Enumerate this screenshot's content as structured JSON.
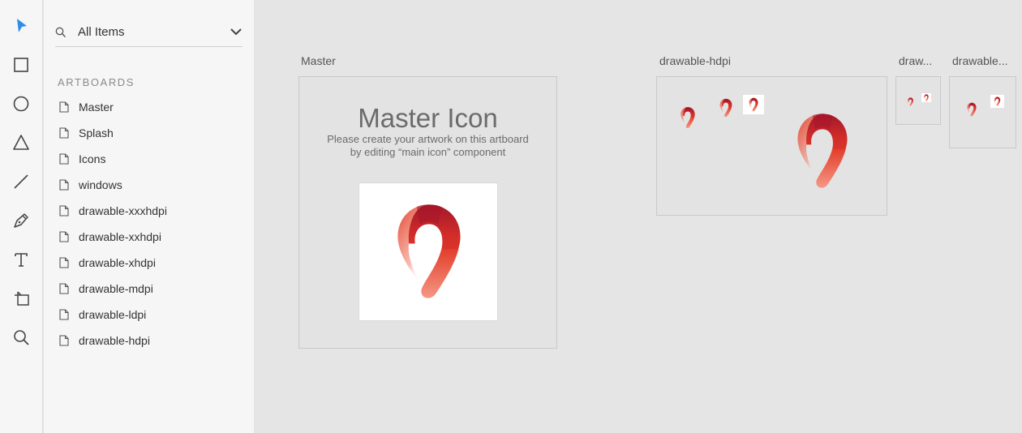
{
  "toolbar": {
    "tools": [
      {
        "name": "select-tool",
        "icon": "arrow-pointer-icon"
      },
      {
        "name": "rectangle-tool",
        "icon": "rectangle-icon"
      },
      {
        "name": "ellipse-tool",
        "icon": "ellipse-icon"
      },
      {
        "name": "polygon-tool",
        "icon": "triangle-icon"
      },
      {
        "name": "line-tool",
        "icon": "line-icon"
      },
      {
        "name": "pen-tool",
        "icon": "pen-icon"
      },
      {
        "name": "text-tool",
        "icon": "text-icon"
      },
      {
        "name": "artboard-tool",
        "icon": "artboard-icon"
      },
      {
        "name": "zoom-tool",
        "icon": "magnifier-icon"
      }
    ],
    "active_color": "#2c8ee8"
  },
  "sidebar": {
    "filter": {
      "value": "All Items"
    },
    "section_title": "ARTBOARDS",
    "items": [
      {
        "label": "Master"
      },
      {
        "label": "Splash"
      },
      {
        "label": "Icons"
      },
      {
        "label": "windows"
      },
      {
        "label": "drawable-xxxhdpi"
      },
      {
        "label": "drawable-xxhdpi"
      },
      {
        "label": "drawable-xhdpi"
      },
      {
        "label": "drawable-mdpi"
      },
      {
        "label": "drawable-ldpi"
      },
      {
        "label": "drawable-hdpi"
      }
    ]
  },
  "canvas": {
    "artboards": [
      {
        "label": "Master"
      },
      {
        "label": "drawable-hdpi"
      },
      {
        "label": "draw..."
      },
      {
        "label": "drawable..."
      }
    ],
    "master": {
      "title": "Master Icon",
      "subtitle_line1": "Please create your artwork on this artboard",
      "subtitle_line2": "by editing “main icon” component"
    },
    "brand_colors": {
      "red": "#e4402a",
      "dark_red": "#b3202e",
      "light": "#f5a090"
    }
  }
}
